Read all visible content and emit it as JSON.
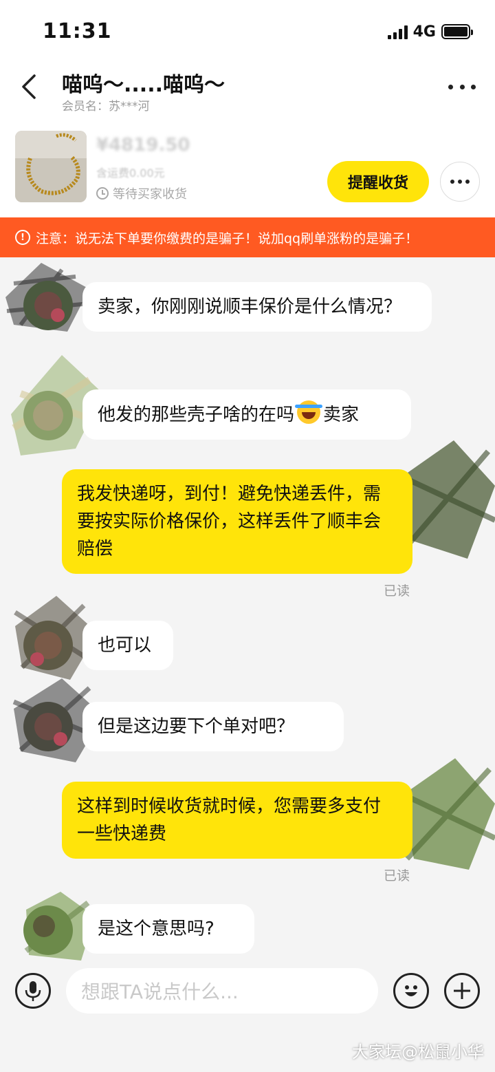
{
  "status_bar": {
    "time": "11:31",
    "network": "4G"
  },
  "header": {
    "title": "喵呜～.....喵呜～",
    "subtitle": "会员名：苏***河"
  },
  "product": {
    "price": "¥4819.50",
    "shipping": "含运费0.00元",
    "status": "等待买家收货",
    "remind_button": "提醒收货"
  },
  "warning": {
    "icon": "!",
    "text": "注意：说无法下单要你缴费的是骗子！说加qq刷单涨粉的是骗子！"
  },
  "messages": [
    {
      "side": "left",
      "text": "卖家，你刚刚说顺丰保价是什么情况？"
    },
    {
      "side": "left",
      "text_before": "他发的那些壳子啥的在吗",
      "emoji": "laughing-crying-emoji",
      "text_after": "卖家"
    },
    {
      "side": "right",
      "text": "我发快递呀，到付！避免快递丢件，需要按实际价格保价，这样丢件了顺丰会赔偿",
      "read": "已读"
    },
    {
      "side": "left",
      "text": "也可以"
    },
    {
      "side": "left",
      "text": "但是这边要下个单对吧？"
    },
    {
      "side": "right",
      "text": "这样到时候收货就时候，您需要多支付一些快递费",
      "read": "已读"
    },
    {
      "side": "left",
      "text": "是这个意思吗?"
    }
  ],
  "input_bar": {
    "placeholder": "想跟TA说点什么...",
    "icons": [
      "microphone-icon",
      "emoji-icon",
      "plus-icon"
    ]
  },
  "watermark": "大家坛@松鼠小华",
  "colors": {
    "accent_yellow": "#ffe40a",
    "warning_orange": "#ff5a22",
    "background": "#f4f4f4"
  }
}
